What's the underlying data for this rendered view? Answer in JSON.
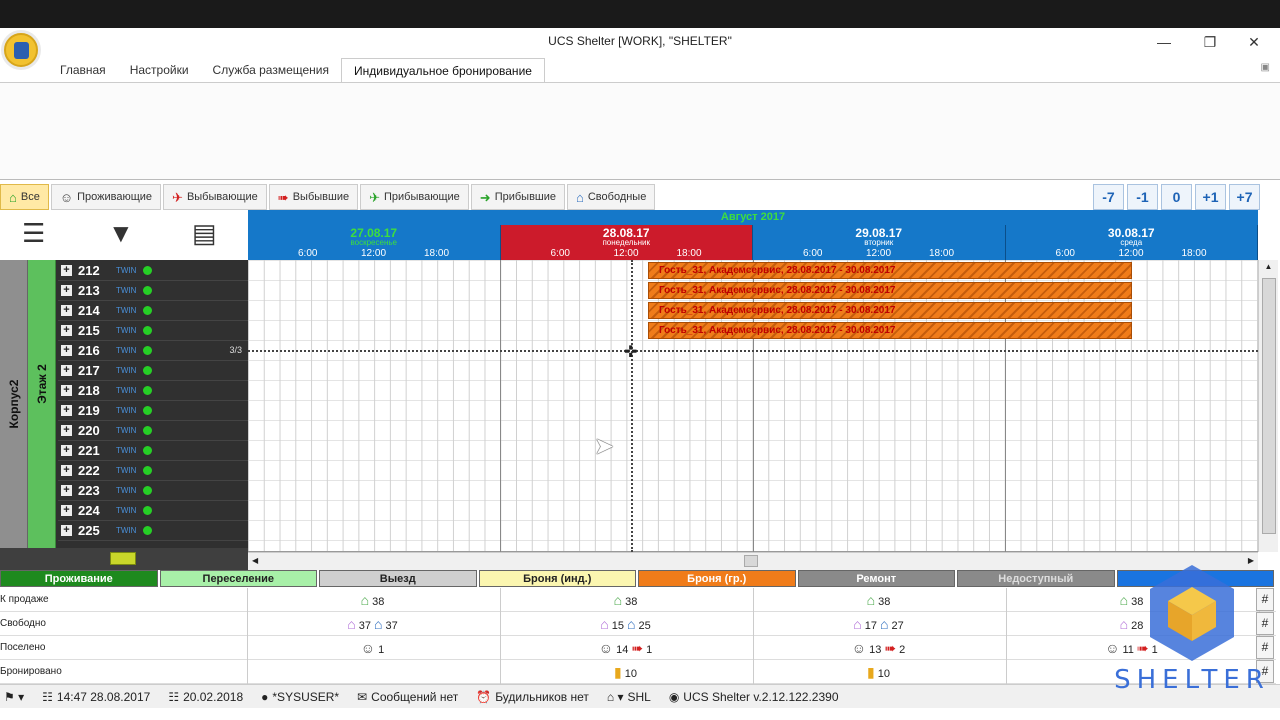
{
  "window": {
    "title": "UCS Shelter [WORK], \"SHELTER\""
  },
  "menu_tabs": [
    {
      "label": "Главная"
    },
    {
      "label": "Настройки"
    },
    {
      "label": "Служба размещения"
    },
    {
      "label": "Индивидуальное бронирование"
    }
  ],
  "filters": [
    {
      "label": "Все",
      "icon": "house-icon",
      "color": "#29a329"
    },
    {
      "label": "Проживающие",
      "icon": "person-icon",
      "color": "#444"
    },
    {
      "label": "Выбывающие",
      "icon": "plane-icon",
      "color": "#d32020"
    },
    {
      "label": "Выбывшие",
      "icon": "exit-icon",
      "color": "#d32020"
    },
    {
      "label": "Прибывающие",
      "icon": "plane-arrive-icon",
      "color": "#29a329"
    },
    {
      "label": "Прибывшие",
      "icon": "enter-icon",
      "color": "#29a329"
    },
    {
      "label": "Свободные",
      "icon": "house-icon",
      "color": "#2f6fbf"
    }
  ],
  "nav": [
    "-7",
    "-1",
    "0",
    "+1",
    "+7"
  ],
  "calendar": {
    "month": "Август 2017",
    "days": [
      {
        "date": "27.08.17",
        "weekday": "воскресенье",
        "bg": "#1578c9",
        "date_color": "#3ede3e"
      },
      {
        "date": "28.08.17",
        "weekday": "понедельник",
        "bg": "#cc1b2b",
        "date_color": "#ffffff"
      },
      {
        "date": "29.08.17",
        "weekday": "вторник",
        "bg": "#1578c9",
        "date_color": "#ffffff"
      },
      {
        "date": "30.08.17",
        "weekday": "среда",
        "bg": "#1578c9",
        "date_color": "#ffffff"
      }
    ],
    "hours": [
      "6:00",
      "12:00",
      "18:00"
    ]
  },
  "building": {
    "korpus": "Корпус2",
    "etazh": "Этаж 2"
  },
  "rooms": [
    {
      "num": "212",
      "type": "TWIN",
      "occ": ""
    },
    {
      "num": "213",
      "type": "TWIN",
      "occ": ""
    },
    {
      "num": "214",
      "type": "TWIN",
      "occ": ""
    },
    {
      "num": "215",
      "type": "TWIN",
      "occ": ""
    },
    {
      "num": "216",
      "type": "TWIN",
      "occ": "3/3"
    },
    {
      "num": "217",
      "type": "TWIN",
      "occ": ""
    },
    {
      "num": "218",
      "type": "TWIN",
      "occ": ""
    },
    {
      "num": "219",
      "type": "TWIN",
      "occ": ""
    },
    {
      "num": "220",
      "type": "TWIN",
      "occ": ""
    },
    {
      "num": "221",
      "type": "TWIN",
      "occ": ""
    },
    {
      "num": "222",
      "type": "TWIN",
      "occ": ""
    },
    {
      "num": "223",
      "type": "TWIN",
      "occ": ""
    },
    {
      "num": "224",
      "type": "TWIN",
      "occ": ""
    },
    {
      "num": "225",
      "type": "TWIN",
      "occ": ""
    }
  ],
  "bookings": [
    {
      "room": "212",
      "text": "Гость_31, Академсервис, 28.08.2017 - 30.08.2017"
    },
    {
      "room": "213",
      "text": "Гость_31, Академсервис, 28.08.2017 - 30.08.2017"
    },
    {
      "room": "214",
      "text": "Гость_31, Академсервис, 28.08.2017 - 30.08.2017"
    },
    {
      "room": "215",
      "text": "Гость_31, Академсервис, 28.08.2017 - 30.08.2017"
    }
  ],
  "legend": [
    {
      "label": "Проживание",
      "bg": "#1e8a1e",
      "color": "#ffffff"
    },
    {
      "label": "Переселение",
      "bg": "#a8f0a8",
      "color": "#222"
    },
    {
      "label": "Выезд",
      "bg": "#cfcfcf",
      "color": "#222"
    },
    {
      "label": "Броня (инд.)",
      "bg": "#fbf6b0",
      "color": "#222"
    },
    {
      "label": "Броня (гр.)",
      "bg": "#f07c1a",
      "color": "#ffffff"
    },
    {
      "label": "Ремонт",
      "bg": "#8a8a8a",
      "color": "#ffffff"
    },
    {
      "label": "Недоступный",
      "bg": "#8a8a8a",
      "color": "#dddddd"
    },
    {
      "label": "",
      "bg": "#1a74e0",
      "color": "#ffffff"
    }
  ],
  "stats": {
    "labels": [
      "К продаже",
      "Свободно",
      "Поселено",
      "Бронировано"
    ],
    "days": [
      {
        "sale": "38",
        "free_a": "37",
        "free_b": "37",
        "settled": "1",
        "settled_out": "",
        "booked": ""
      },
      {
        "sale": "38",
        "free_a": "15",
        "free_b": "25",
        "settled": "14",
        "settled_out": "1",
        "booked": "10"
      },
      {
        "sale": "38",
        "free_a": "17",
        "free_b": "27",
        "settled": "13",
        "settled_out": "2",
        "booked": "10"
      },
      {
        "sale": "38",
        "free_a": "28",
        "free_b": "",
        "settled": "11",
        "settled_out": "1",
        "booked": ""
      }
    ]
  },
  "status": {
    "datetime": "14:47 28.08.2017",
    "date2": "20.02.2018",
    "user": "*SYSUSER*",
    "messages": "Сообщений нет",
    "alarms": "Будильников нет",
    "hotel": "SHL",
    "version": "UCS Shelter v.2.12.122.2390"
  },
  "brand": {
    "text": "SHELTER"
  }
}
